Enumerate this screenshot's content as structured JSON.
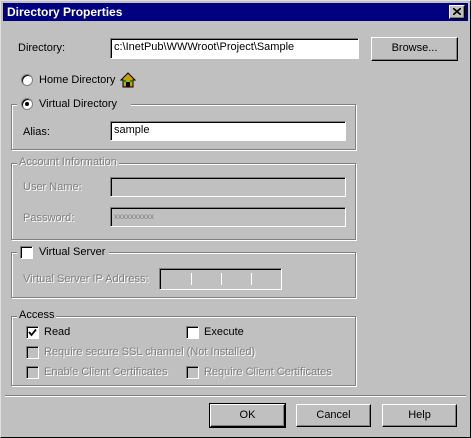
{
  "window": {
    "title": "Directory Properties"
  },
  "directory": {
    "label": "Directory:",
    "value": "c:\\InetPub\\WWWroot\\Project\\Sample",
    "browse_label": "Browse..."
  },
  "home_directory": {
    "label": "Home Directory",
    "selected": false
  },
  "virtual_directory": {
    "label": "Virtual Directory",
    "selected": true,
    "alias_label": "Alias:",
    "alias_value": "sample"
  },
  "account": {
    "group_label": "Account Information",
    "user_label": "User Name:",
    "user_value": "",
    "password_label": "Password:",
    "password_value": "xxxxxxxxxx"
  },
  "virtual_server": {
    "label": "Virtual Server",
    "checked": false,
    "ip_label": "Virtual Server IP Address:",
    "ip_octets": [
      "",
      "",
      "",
      ""
    ]
  },
  "access": {
    "group_label": "Access",
    "read": {
      "label": "Read",
      "checked": true
    },
    "execute": {
      "label": "Execute",
      "checked": false
    },
    "ssl": {
      "label": "Require secure SSL channel (Not Installed)",
      "checked": false,
      "enabled": false
    },
    "client_certs": {
      "label": "Enable Client Certificates",
      "checked": false,
      "enabled": false
    },
    "require_client_certs": {
      "label": "Require Client Certificates",
      "checked": false,
      "enabled": false
    }
  },
  "buttons": {
    "ok": "OK",
    "cancel": "Cancel",
    "help": "Help"
  },
  "colors": {
    "face": "#c0c0c0",
    "title_bar": "#000080",
    "disabled_text": "#808080"
  },
  "icons": {
    "close": "close-icon",
    "home": "home-directory-icon"
  }
}
